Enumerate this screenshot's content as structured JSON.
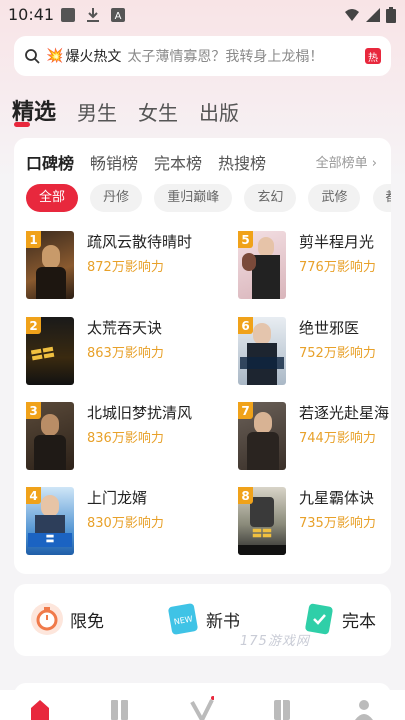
{
  "status_bar": {
    "time": "10:41"
  },
  "search": {
    "hot_label": "爆火热文",
    "placeholder": "太子薄情寡恩？我转身上龙榻！",
    "badge": "热"
  },
  "channel_tabs": [
    "精选",
    "男生",
    "女生",
    "出版"
  ],
  "rank_tabs": [
    "口碑榜",
    "畅销榜",
    "完本榜",
    "热搜榜"
  ],
  "all_rank_label": "全部榜单 ›",
  "tags": [
    "全部",
    "丹修",
    "重归巅峰",
    "玄幻",
    "武修",
    "都市"
  ],
  "books": [
    {
      "rank": "1",
      "title": "疏风云散待晴时",
      "popularity": "872万影响力"
    },
    {
      "rank": "2",
      "title": "太荒吞天诀",
      "popularity": "863万影响力"
    },
    {
      "rank": "3",
      "title": "北城旧梦扰清风",
      "popularity": "836万影响力"
    },
    {
      "rank": "4",
      "title": "上门龙婿",
      "popularity": "830万影响力"
    },
    {
      "rank": "5",
      "title": "剪半程月光",
      "popularity": "776万影响力"
    },
    {
      "rank": "6",
      "title": "绝世邪医",
      "popularity": "752万影响力"
    },
    {
      "rank": "7",
      "title": "若逐光赴星海",
      "popularity": "744万影响力"
    },
    {
      "rank": "8",
      "title": "九星霸体诀",
      "popularity": "735万影响力"
    }
  ],
  "categories": [
    "限免",
    "新书",
    "完本"
  ],
  "watermark": "175游戏网",
  "colors": {
    "accent": "#e8283d",
    "popularity": "#e8a12a",
    "rank_badge": "#f0a21a"
  }
}
